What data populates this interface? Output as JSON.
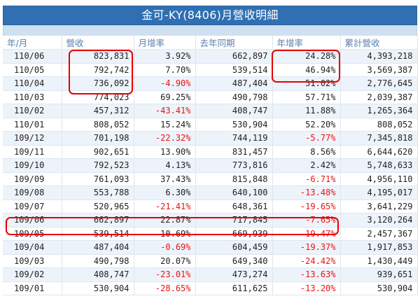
{
  "title": "金可-KY(8406)月營收明細",
  "headers": [
    "年/月",
    "營收",
    "月增率",
    "去年同期",
    "年增率",
    "累計營收"
  ],
  "rows": [
    [
      "110/06",
      "823,831",
      "3.92%",
      "662,897",
      "24.28%",
      "4,393,218"
    ],
    [
      "110/05",
      "792,742",
      "7.70%",
      "539,514",
      "46.94%",
      "3,569,387"
    ],
    [
      "110/04",
      "736,092",
      "-4.90%",
      "487,404",
      "51.02%",
      "2,776,645"
    ],
    [
      "110/03",
      "774,023",
      "69.25%",
      "490,798",
      "57.71%",
      "2,039,387"
    ],
    [
      "110/02",
      "457,312",
      "-43.41%",
      "408,747",
      "11.88%",
      "1,265,364"
    ],
    [
      "110/01",
      "808,052",
      "15.24%",
      "530,904",
      "52.20%",
      "808,052"
    ],
    [
      "109/12",
      "701,198",
      "-22.32%",
      "744,119",
      "-5.77%",
      "7,345,818"
    ],
    [
      "109/11",
      "902,651",
      "13.90%",
      "831,457",
      "8.56%",
      "6,644,620"
    ],
    [
      "109/10",
      "792,523",
      "4.13%",
      "773,816",
      "2.42%",
      "5,748,633"
    ],
    [
      "109/09",
      "761,093",
      "37.43%",
      "815,848",
      "-6.71%",
      "4,956,110"
    ],
    [
      "109/08",
      "553,788",
      "6.30%",
      "640,100",
      "-13.48%",
      "4,195,017"
    ],
    [
      "109/07",
      "520,965",
      "-21.41%",
      "648,361",
      "-19.65%",
      "3,641,229"
    ],
    [
      "109/06",
      "662,897",
      "22.87%",
      "717,845",
      "-7.65%",
      "3,120,264"
    ],
    [
      "109/05",
      "539,514",
      "10.69%",
      "669,939",
      "-19.47%",
      "2,457,367"
    ],
    [
      "109/04",
      "487,404",
      "-0.69%",
      "604,459",
      "-19.37%",
      "1,917,853"
    ],
    [
      "109/03",
      "490,798",
      "20.07%",
      "649,340",
      "-24.42%",
      "1,430,449"
    ],
    [
      "109/02",
      "408,747",
      "-23.01%",
      "473,274",
      "-13.63%",
      "939,651"
    ],
    [
      "109/01",
      "530,904",
      "-28.65%",
      "611,625",
      "-13.20%",
      "530,904"
    ]
  ],
  "colors": {
    "title_bg": "#2f6fb2",
    "sub_bar": "#cfe0f1",
    "header_text": "#5a7fae",
    "negative": "#ee1111",
    "highlight": "#e60000"
  }
}
